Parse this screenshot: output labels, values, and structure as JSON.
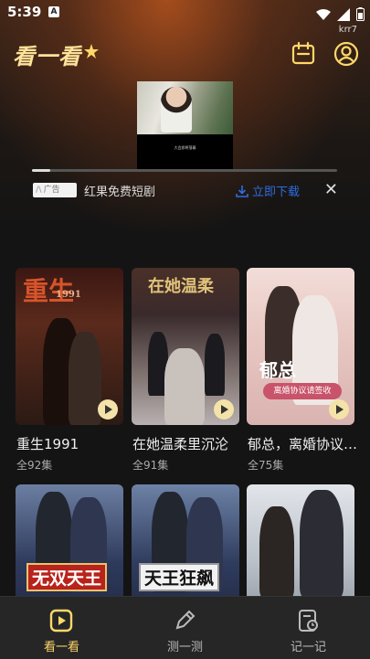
{
  "status": {
    "time": "5:39",
    "notification_icon": "A"
  },
  "header": {
    "user_tag": "krr7",
    "logo": "看一看"
  },
  "ad": {
    "badge": "广告",
    "title": "红果免费短剧",
    "download_label": "立即下载",
    "close_label": "✕",
    "progress": 0.06
  },
  "video": {
    "subtitle": "大会即将落幕"
  },
  "dramas": [
    {
      "title": "重生1991",
      "episodes": "全92集",
      "poster_text": "重生",
      "poster_sub": "1991"
    },
    {
      "title": "在她温柔里沉沦",
      "episodes": "全91集",
      "poster_text": "在她温柔"
    },
    {
      "title": "郁总，离婚协议请签收",
      "episodes": "全75集",
      "poster_text": "郁总",
      "poster_sub": "离婚协议请签收"
    },
    {
      "title": "",
      "episodes": "",
      "poster_text": "无双天王"
    },
    {
      "title": "",
      "episodes": "",
      "poster_text": "天王狂飙"
    },
    {
      "title": "",
      "episodes": "",
      "poster_text": ""
    }
  ],
  "tabs": [
    {
      "label": "看一看",
      "icon": "play-square-icon",
      "active": true
    },
    {
      "label": "测一测",
      "icon": "pencil-icon",
      "active": false
    },
    {
      "label": "记一记",
      "icon": "notebook-clock-icon",
      "active": false
    }
  ],
  "colors": {
    "accent": "#ffd86a",
    "download_blue": "#2b6de3",
    "background": "#141414"
  }
}
